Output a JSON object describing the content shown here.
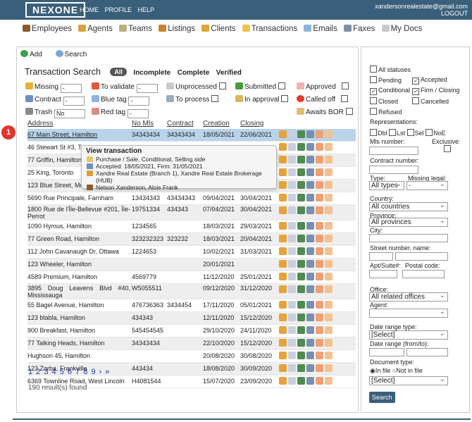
{
  "header": {
    "logo": "NEXONE",
    "nav": [
      "HOME",
      "PROFILE",
      "HELP"
    ],
    "email": "xandersonrealestate@gmail.com",
    "logout": "LOGOUT"
  },
  "mainnav": [
    "Employees",
    "Agents",
    "Teams",
    "Listings",
    "Clients",
    "Transactions",
    "Emails",
    "Faxes",
    "My Docs"
  ],
  "toolbar": {
    "add": "Add",
    "search": "Search"
  },
  "title": "Transaction Search",
  "tabs": {
    "all": "All",
    "incomplete": "Incomplete",
    "complete": "Complete",
    "verified": "Verified"
  },
  "filters": {
    "missing": "Missing",
    "to_validate": "To validate",
    "unprocessed": "Unprocessed",
    "submitted": "Submitted",
    "approved": "Approved",
    "contract": "Contract",
    "blue_tag": "Blue tag",
    "to_process": "To process",
    "in_approval": "In approval",
    "called_off": "Called off",
    "trash": "Trash",
    "trash_value": "No",
    "red_tag": "Red tag",
    "awaits_bor": "Awaits BOR"
  },
  "columns": {
    "address": "Address",
    "mls": "No Mls",
    "contract": "Contract",
    "creation": "Creation",
    "closing": "Closing"
  },
  "rows": [
    {
      "address": "67 Main Street, Hamilton",
      "mls": "34343434",
      "contract": "34343434",
      "creation": "18/05/2021",
      "closing": "22/06/2021"
    },
    {
      "address": "46 Stewart St #3, Toronto",
      "mls": "",
      "contract": "",
      "creation": "",
      "closing": ""
    },
    {
      "address": "77 Griffin, Hamilton",
      "mls": "",
      "contract": "",
      "creation": "",
      "closing": ""
    },
    {
      "address": "25 King, Toronto",
      "mls": "",
      "contract": "",
      "creation": "",
      "closing": ""
    },
    {
      "address": "123 Blue Street, Montreal",
      "mls": "",
      "contract": "",
      "creation": "",
      "closing": ""
    },
    {
      "address": "5690 Rue Principale, Farnham",
      "mls": "13434343",
      "contract": "43434343",
      "creation": "09/04/2021",
      "closing": "30/04/2021"
    },
    {
      "address": "1800 Rue de l'Île-Bellevue #201, Île-Perrot",
      "mls": "19751334",
      "contract": "434343",
      "creation": "07/04/2021",
      "closing": "30/04/2021"
    },
    {
      "address": "1090 Hymus, Hamilton",
      "mls": "1234565",
      "contract": "",
      "creation": "18/03/2021",
      "closing": "29/03/2021"
    },
    {
      "address": "77 Green Road, Hamilton",
      "mls": "323232323",
      "contract": "323232",
      "creation": "18/03/2021",
      "closing": "20/04/2021"
    },
    {
      "address": "112 John Cavanaugh Dr, Ottawa",
      "mls": "1224653",
      "contract": "",
      "creation": "10/02/2021",
      "closing": "31/03/2021"
    },
    {
      "address": "123 Wheeler, Hamilton",
      "mls": "",
      "contract": "",
      "creation": "20/01/2021",
      "closing": ""
    },
    {
      "address": "4589 Premium, Hamilton",
      "mls": "4569779",
      "contract": "",
      "creation": "11/12/2020",
      "closing": "25/01/2021"
    },
    {
      "address": "3895 Doug Leavens Blvd #40, Mississauga",
      "mls": "W5055511",
      "contract": "",
      "creation": "09/12/2020",
      "closing": "31/12/2020"
    },
    {
      "address": "55 Bagel Avenue, Hamilton",
      "mls": "476736363",
      "contract": "3434454",
      "creation": "17/11/2020",
      "closing": "05/01/2021"
    },
    {
      "address": "123 blabla, Hamilton",
      "mls": "434343",
      "contract": "",
      "creation": "12/11/2020",
      "closing": "15/12/2020"
    },
    {
      "address": "900 Breakfast, Hamilton",
      "mls": "545454545",
      "contract": "",
      "creation": "29/10/2020",
      "closing": "24/11/2020"
    },
    {
      "address": "77 Talking Heads, Hamilton",
      "mls": "34343434",
      "contract": "",
      "creation": "22/10/2020",
      "closing": "15/12/2020"
    },
    {
      "address": "Hughson 45, Hamilton",
      "mls": "",
      "contract": "",
      "creation": "20/08/2020",
      "closing": "30/08/2020"
    },
    {
      "address": "123 Zorba, Frankville",
      "mls": "443434",
      "contract": "",
      "creation": "18/08/2020",
      "closing": "30/09/2020"
    },
    {
      "address": "6369 Townline Road, West Lincoln",
      "mls": "H4081544",
      "contract": "",
      "creation": "15/07/2020",
      "closing": "23/09/2020"
    }
  ],
  "pager": "1 2 3 4 5 6 7 8 9 › »",
  "results": "190 result(s) found",
  "tooltip": {
    "title": "View transaction",
    "line1": "Purchase / Sale, Conditional, Selling side",
    "line2": "Accepted: 18/05/2021, Firm: 31/05/2021",
    "line3": "Xandre Real Estate (Branch 1), Xandre Real Estate Brokerage (HUB)",
    "line4": "Nelson Xanderson, Alois Frank"
  },
  "badge": "1",
  "side": {
    "all_statuses": "All statuses",
    "pending": "Pending",
    "accepted": "Accepted",
    "conditional": "Conditional",
    "firm_closing": "Firm / Closing",
    "closed": "Closed",
    "cancelled": "Cancelled",
    "refused": "Refused",
    "representations": "Representations:",
    "dbl": "Dbl",
    "lst": "Lst",
    "sel": "Sel",
    "noe": "NoE",
    "mls_number": "Mls number:",
    "exclusive": "Exclusive:",
    "contract_number": "Contract number:",
    "type": "Type:",
    "missing_legal": "Missing legal:",
    "type_value": "All types",
    "missing_value": "-",
    "country": "Country:",
    "country_value": "All countries",
    "province": "Province:",
    "province_value": "All provinces",
    "city": "City:",
    "street": "Street number, name:",
    "apt": "Apt/Suite#:",
    "postal": "Postal code:",
    "office": "Office:",
    "office_value": "All related offices",
    "agent": "Agent:",
    "date_range_type": "Date range type:",
    "select": "[Select]",
    "date_range": "Date range (from/to):",
    "doc_type": "Document type:",
    "in_file": "In file",
    "not_in_file": "Not in file",
    "search": "Search"
  }
}
